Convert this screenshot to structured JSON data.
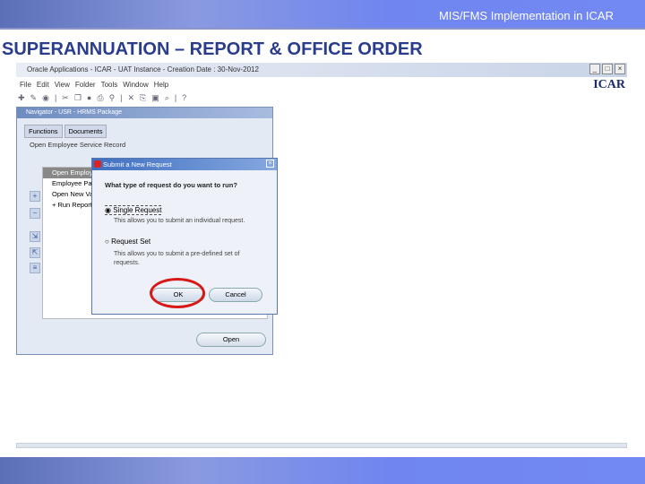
{
  "header": {
    "title": "MIS/FMS Implementation in ICAR"
  },
  "slide": {
    "title": "SUPERANNUATION – REPORT & OFFICE ORDER"
  },
  "window": {
    "title": "Oracle Applications - ICAR - UAT Instance - Creation Date : 30-Nov-2012",
    "logo": "ICAR",
    "menu": [
      "File",
      "Edit",
      "View",
      "Folder",
      "Tools",
      "Window",
      "Help"
    ]
  },
  "navigator": {
    "title": "Navigator - USR - HRMS Package",
    "tabs": [
      "Functions",
      "Documents"
    ],
    "heading": "Open Employee Service Record",
    "items": [
      "Open Employees",
      "Employee Pay B",
      "Open New Vari",
      "+ Run Reports C"
    ],
    "open_label": "Open"
  },
  "dialog": {
    "title": "Submit a New Request",
    "question": "What type of request do you want to run?",
    "option1": "Single Request",
    "option1_desc": "This allows you to submit an individual request.",
    "option2": "Request Set",
    "option2_desc": "This allows you to submit a pre-defined set of requests.",
    "ok": "OK",
    "cancel": "Cancel"
  },
  "colors": {
    "accent": "#2a3c8c",
    "highlight": "#d81818"
  }
}
